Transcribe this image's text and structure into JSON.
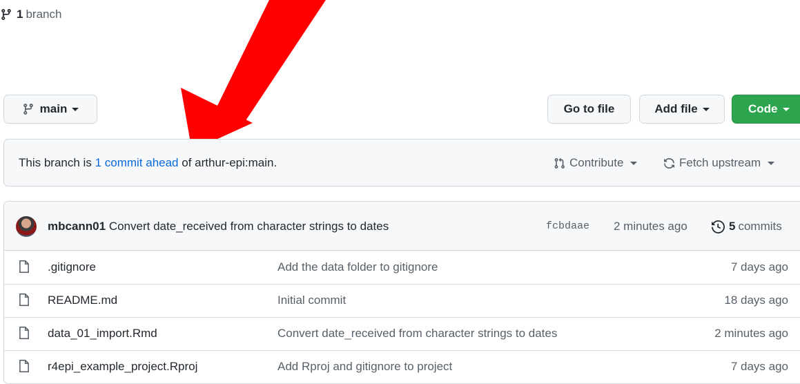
{
  "branch_selector": {
    "label": "main"
  },
  "branches_link": {
    "count": "1",
    "label": "branch"
  },
  "toolbar": {
    "goto_file": "Go to file",
    "add_file": "Add file",
    "code": "Code"
  },
  "ahead_banner": {
    "prefix": "This branch is",
    "link": "1 commit ahead",
    "suffix": "of arthur-epi:main.",
    "contribute": "Contribute",
    "fetch_upstream": "Fetch upstream"
  },
  "latest_commit": {
    "author": "mbcann01",
    "message": "Convert date_received from character strings to dates",
    "sha": "fcbdaae",
    "time": "2 minutes ago",
    "commit_count": "5",
    "commits_label": "commits"
  },
  "files": [
    {
      "name": ".gitignore",
      "message": "Add the data folder to gitignore",
      "date": "7 days ago"
    },
    {
      "name": "README.md",
      "message": "Initial commit",
      "date": "18 days ago"
    },
    {
      "name": "data_01_import.Rmd",
      "message": "Convert date_received from character strings to dates",
      "date": "2 minutes ago"
    },
    {
      "name": "r4epi_example_project.Rproj",
      "message": "Add Rproj and gitignore to project",
      "date": "7 days ago"
    }
  ],
  "icons": {
    "branch": "git-branch-icon",
    "file": "file-icon",
    "history": "history-icon",
    "pull_request": "git-pull-request-icon",
    "sync": "sync-icon"
  },
  "colors": {
    "accent_link": "#0969da",
    "code_button": "#2da44e",
    "annotation_arrow": "#ff0000"
  }
}
